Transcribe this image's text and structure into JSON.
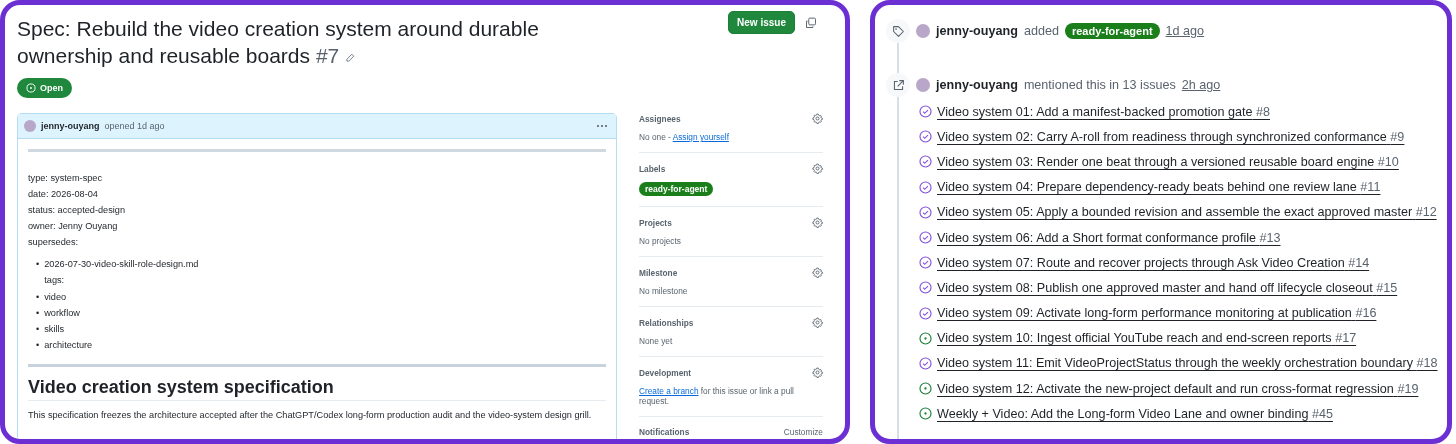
{
  "issue": {
    "title": "Spec: Rebuild the video creation system around durable ownership and reusable boards",
    "number": "#7",
    "status": "Open",
    "new_issue_button": "New issue"
  },
  "comment": {
    "author": "jenny-ouyang",
    "action": "opened 1d ago",
    "frontmatter": [
      "type: system-spec",
      "date: 2026-08-04",
      "status: accepted-design",
      "owner: Jenny Ouyang",
      "supersedes:"
    ],
    "supersedes": [
      {
        "bullet": "•",
        "text": "2026-07-30-video-skill-role-design.md",
        "note": "tags:"
      }
    ],
    "tags": [
      {
        "bullet": "•",
        "text": "video"
      },
      {
        "bullet": "•",
        "text": "workflow"
      },
      {
        "bullet": "•",
        "text": "skills"
      },
      {
        "bullet": "•",
        "text": "architecture"
      }
    ],
    "heading": "Video creation system specification",
    "paragraph": "This specification freezes the architecture accepted after the ChatGPT/Codex long-form production audit and the video-system design grill."
  },
  "sidebar": {
    "sections": [
      {
        "title": "Assignees",
        "kind": "assignees",
        "text": "No one - ",
        "link": "Assign yourself"
      },
      {
        "title": "Labels",
        "kind": "labels",
        "labels": [
          "ready-for-agent"
        ]
      },
      {
        "title": "Projects",
        "kind": "text",
        "text": "No projects"
      },
      {
        "title": "Milestone",
        "kind": "text",
        "text": "No milestone"
      },
      {
        "title": "Relationships",
        "kind": "text",
        "text": "None yet"
      },
      {
        "title": "Development",
        "kind": "development",
        "link": "Create a branch",
        "text": " for this issue or link a pull request."
      }
    ],
    "notifications": {
      "title": "Notifications",
      "action": "Customize"
    }
  },
  "timeline": [
    {
      "kind": "labeled",
      "user": "jenny-ouyang",
      "action": "added",
      "label": "ready-for-agent",
      "time": "1d ago"
    },
    {
      "kind": "mentioned",
      "user": "jenny-ouyang",
      "action": "mentioned this in 13 issues",
      "time": "2h ago",
      "issues": [
        {
          "title": "Video system 01: Add a manifest-backed promotion gate",
          "number": "#8",
          "kind": "closed"
        },
        {
          "title": "Video system 02: Carry A-roll from readiness through synchronized conformance",
          "number": "#9",
          "kind": "closed"
        },
        {
          "title": "Video system 03: Render one beat through a versioned reusable board engine",
          "number": "#10",
          "kind": "closed"
        },
        {
          "title": "Video system 04: Prepare dependency-ready beats behind one review lane",
          "number": "#11",
          "kind": "closed"
        },
        {
          "title": "Video system 05: Apply a bounded revision and assemble the exact approved master",
          "number": "#12",
          "kind": "closed"
        },
        {
          "title": "Video system 06: Add a Short format conformance profile",
          "number": "#13",
          "kind": "closed"
        },
        {
          "title": "Video system 07: Route and recover projects through Ask Video Creation",
          "number": "#14",
          "kind": "closed"
        },
        {
          "title": "Video system 08: Publish one approved master and hand off lifecycle closeout",
          "number": "#15",
          "kind": "closed"
        },
        {
          "title": "Video system 09: Activate long-form performance monitoring at publication",
          "number": "#16",
          "kind": "closed"
        },
        {
          "title": "Video system 10: Ingest official YouTube reach and end-screen reports",
          "number": "#17",
          "kind": "open"
        },
        {
          "title": "Video system 11: Emit VideoProjectStatus through the weekly orchestration boundary",
          "number": "#18",
          "kind": "closed"
        },
        {
          "title": "Video system 12: Activate the new-project default and run cross-format regression",
          "number": "#19",
          "kind": "open"
        },
        {
          "title": "Weekly + Video: Add the Long-form Video Lane and owner binding",
          "number": "#45",
          "kind": "open"
        }
      ]
    }
  ]
}
